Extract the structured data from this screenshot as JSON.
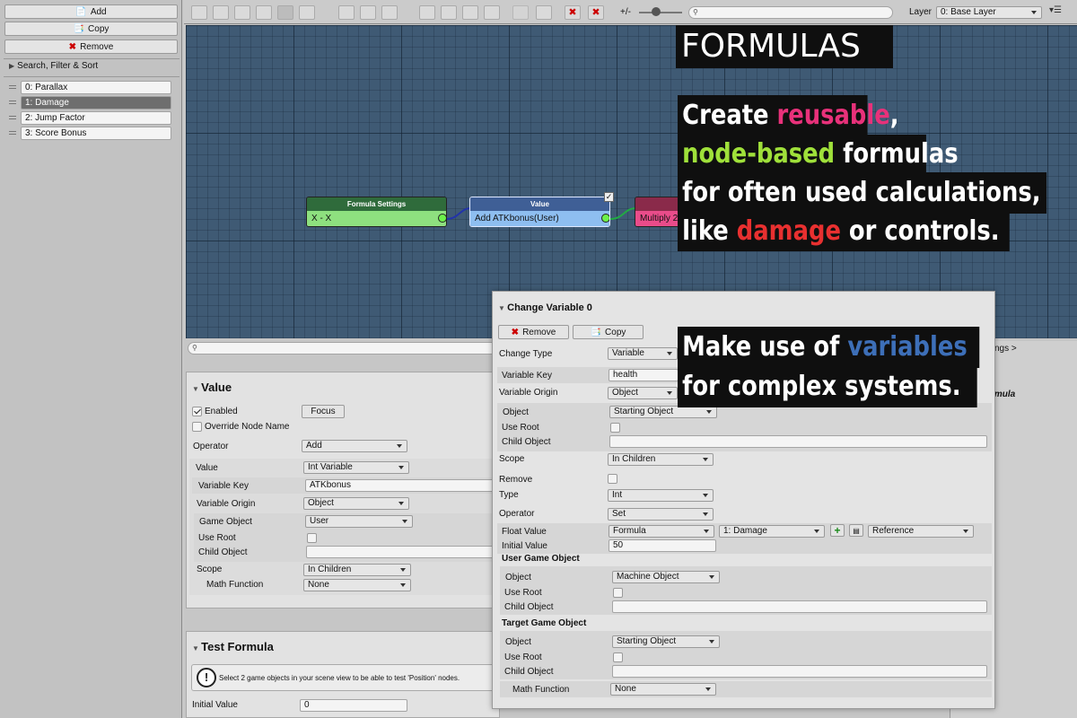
{
  "left_panel": {
    "add": "Add",
    "copy": "Copy",
    "remove": "Remove",
    "search_filter": "Search, Filter & Sort",
    "formulas": [
      {
        "label": "0: Parallax",
        "selected": false
      },
      {
        "label": "1: Damage",
        "selected": true
      },
      {
        "label": "2: Jump Factor",
        "selected": false
      },
      {
        "label": "3: Score Bonus",
        "selected": false
      }
    ]
  },
  "toolbar": {
    "zoom_label": "+/-",
    "zoom_level": 0.4,
    "layer_label": "Layer",
    "layer_value": "0: Base Layer",
    "search_placeholder": ""
  },
  "graph": {
    "nodes": [
      {
        "title": "Formula Settings",
        "body": "X - X"
      },
      {
        "title": "Value",
        "body": "Add ATKbonus(User)"
      },
      {
        "title": "",
        "body": "Multiply 2"
      }
    ]
  },
  "promo": {
    "title": "FORMULAS",
    "l1a": "Create ",
    "l1b": "reusable",
    ",": ",",
    "l2a": "node-based",
    "l2b": " formulas",
    "l3": "for often used calculations,",
    "l4a": "like ",
    "l4b": "damage",
    "l4c": " or controls.",
    "m1a": "Make use of ",
    "m1b": "variables",
    "m2": "for complex systems.",
    "colors": {
      "pink": "#e8317a",
      "green": "#9fe03a",
      "red": "#e83030",
      "blue": "#3d6fb8"
    }
  },
  "inspector": {
    "title": "Value",
    "enabled": "Enabled",
    "focus": "Focus",
    "override": "Override Node Name",
    "operator_label": "Operator",
    "operator": "Add",
    "value_label": "Value",
    "value": "Int Variable",
    "varkey_label": "Variable Key",
    "varkey": "ATKbonus",
    "varorigin_label": "Variable Origin",
    "varorigin": "Object",
    "gameobj_label": "Game Object",
    "gameobj": "User",
    "useroot": "Use Root",
    "childobj": "Child Object",
    "scope_label": "Scope",
    "scope": "In Children",
    "mathfn_label": "Math Function",
    "mathfn": "None"
  },
  "test": {
    "title": "Test Formula",
    "info": "Select 2 game objects in your scene view to be able to test 'Position' nodes.",
    "initial_label": "Initial Value",
    "initial": "0"
  },
  "right_panel": {
    "tab": "ngs >",
    "italic": "rmula"
  },
  "change": {
    "title": "Change Variable 0",
    "remove": "Remove",
    "copy": "Copy",
    "changetype_label": "Change Type",
    "changetype": "Variable",
    "varkey_label": "Variable Key",
    "varkey": "health",
    "varorigin_label": "Variable Origin",
    "varorigin": "Object",
    "object_label": "Object",
    "object": "Starting Object",
    "useroot": "Use Root",
    "childobj": "Child Object",
    "scope_label": "Scope",
    "scope": "In Children",
    "remove_label": "Remove",
    "type_label": "Type",
    "type": "Int",
    "operator_label": "Operator",
    "operator": "Set",
    "float_label": "Float Value",
    "float_type": "Formula",
    "float_formula": "1: Damage",
    "float_ref": "Reference",
    "initial_label": "Initial Value",
    "initial": "50",
    "ugo": "User Game Object",
    "ugo_object": "Machine Object",
    "tgo": "Target Game Object",
    "tgo_object": "Starting Object",
    "mathfn_label": "Math Function",
    "mathfn": "None"
  }
}
